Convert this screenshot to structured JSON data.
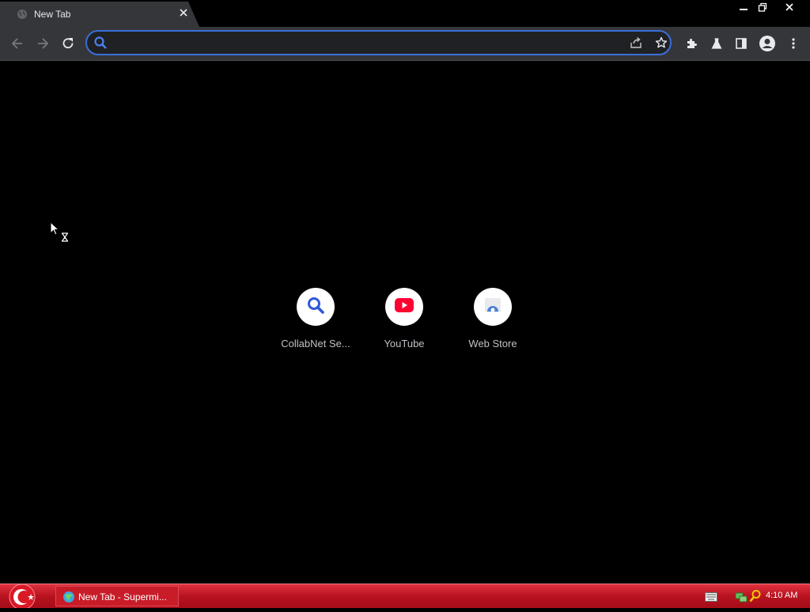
{
  "browser": {
    "tab": {
      "title": "New Tab",
      "favicon": "globe-icon"
    },
    "window_controls": [
      "minimize-icon",
      "restore-icon",
      "close-icon"
    ],
    "toolbar": {
      "omnibox": {
        "value": "",
        "placeholder": ""
      },
      "icons": [
        "back-arrow-icon",
        "forward-arrow-icon",
        "reload-icon",
        "share-icon",
        "star-icon",
        "puzzle-icon",
        "labs-flask-icon",
        "side-panel-icon",
        "profile-icon",
        "menu-kebab-icon"
      ],
      "accent_color": "#3b6fd8"
    }
  },
  "shortcuts": [
    {
      "label": "CollabNet Se...",
      "icon": "search-icon",
      "icon_color": "#2f58d8"
    },
    {
      "label": "YouTube",
      "icon": "youtube-icon",
      "icon_color": "#ff0033"
    },
    {
      "label": "Web Store",
      "icon": "web-store-icon",
      "icon_color": "#4a7fd6"
    }
  ],
  "taskbar": {
    "task_label": "New Tab - Supermi...",
    "clock": "4:10 AM",
    "color": "#c81c28"
  }
}
